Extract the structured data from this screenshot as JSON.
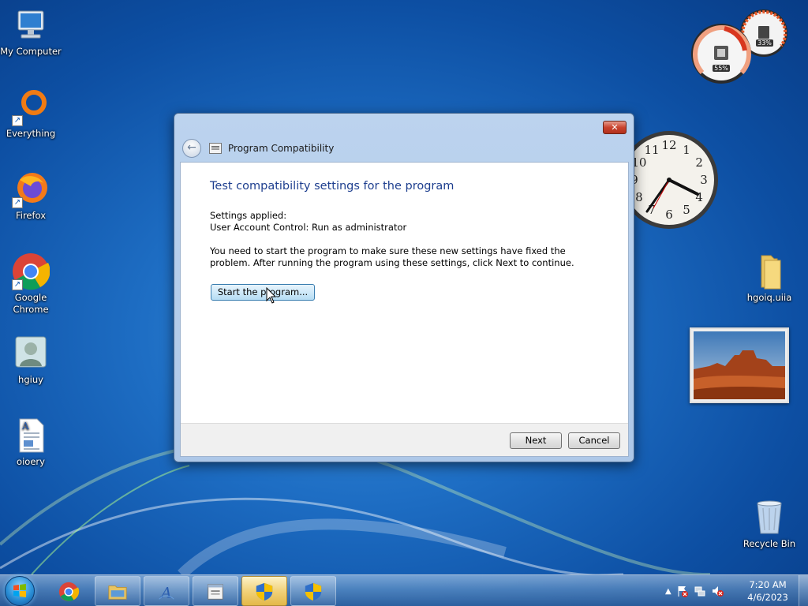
{
  "desktop": {
    "icons": [
      {
        "label": "My Computer",
        "icon": "computer-icon"
      },
      {
        "label": "Everything",
        "icon": "everything-search-icon"
      },
      {
        "label": "Firefox",
        "icon": "firefox-icon"
      },
      {
        "label": "Google Chrome",
        "icon": "chrome-icon"
      },
      {
        "label": "hgiuy",
        "icon": "user-account-icon"
      },
      {
        "label": "oioery",
        "icon": "document-icon"
      },
      {
        "label": "hgoiq.uiia",
        "icon": "folder-icon"
      },
      {
        "label": "Recycle Bin",
        "icon": "recycle-bin-icon"
      }
    ]
  },
  "gadgets": {
    "cpu_meter": {
      "cpu_percent_label": "55%",
      "memory_percent_label": "33%",
      "cpu_percent": 55,
      "memory_percent": 33
    },
    "clock": {
      "numerals": [
        "12",
        "1",
        "2",
        "3",
        "4",
        "5",
        "6",
        "7",
        "8",
        "9",
        "10",
        "11"
      ]
    }
  },
  "dialog": {
    "title": "Program Compatibility",
    "close_glyph": "✕",
    "back_glyph": "←",
    "heading": "Test compatibility settings for the program",
    "settings_label": "Settings applied:",
    "settings_value": "User Account Control:  Run as administrator",
    "instructions": "You need to start the program to make sure these new settings have fixed the problem. After running the program using these settings, click Next to continue.",
    "start_button": "Start the program...",
    "next_button": "Next",
    "cancel_button": "Cancel"
  },
  "taskbar": {
    "time": "7:20 AM",
    "date": "4/6/2023",
    "tray_arrow": "▲"
  }
}
